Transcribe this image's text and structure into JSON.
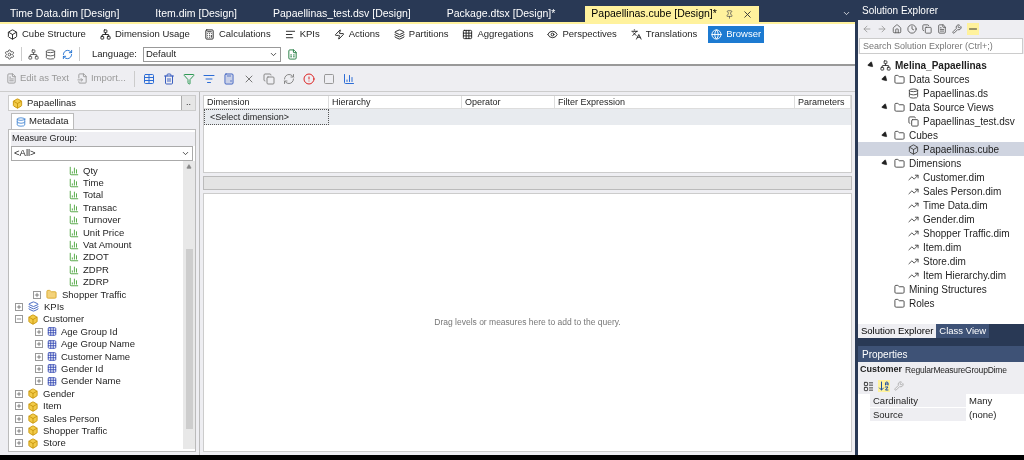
{
  "document_tabs": [
    {
      "label": "Time Data.dim [Design]",
      "selected": false
    },
    {
      "label": "Item.dim [Design]",
      "selected": false
    },
    {
      "label": "Papaellinas_test.dsv [Design]",
      "selected": false
    },
    {
      "label": "Package.dtsx [Design]*",
      "selected": false
    },
    {
      "label": "Papaellinas.cube [Design]*",
      "selected": true
    }
  ],
  "designer_tabs": [
    {
      "label": "Cube Structure",
      "selected": false
    },
    {
      "label": "Dimension Usage",
      "selected": false
    },
    {
      "label": "Calculations",
      "selected": false
    },
    {
      "label": "KPIs",
      "selected": false
    },
    {
      "label": "Actions",
      "selected": false
    },
    {
      "label": "Partitions",
      "selected": false
    },
    {
      "label": "Aggregations",
      "selected": false
    },
    {
      "label": "Perspectives",
      "selected": false
    },
    {
      "label": "Translations",
      "selected": false
    },
    {
      "label": "Browser",
      "selected": true
    }
  ],
  "browser_toolbar": {
    "language_label": "Language:",
    "language_value": "Default"
  },
  "query_toolbar": {
    "edit_as_text": "Edit as Text",
    "import": "Import..."
  },
  "cube_selector": {
    "value": "Papaellinas",
    "button": ".."
  },
  "metadata_tab": {
    "label": "Metadata",
    "selected": true
  },
  "measure_group": {
    "label": "Measure Group:",
    "value": "<All>"
  },
  "metadata_tree": [
    {
      "kind": "measure",
      "label": "Qty"
    },
    {
      "kind": "measure",
      "label": "Time"
    },
    {
      "kind": "measure",
      "label": "Total"
    },
    {
      "kind": "measure",
      "label": "Transac"
    },
    {
      "kind": "measure",
      "label": "Turnover"
    },
    {
      "kind": "measure",
      "label": "Unit Price"
    },
    {
      "kind": "measure",
      "label": "Vat Amount"
    },
    {
      "kind": "measure",
      "label": "ZDOT"
    },
    {
      "kind": "measure",
      "label": "ZDPR"
    },
    {
      "kind": "measure",
      "label": "ZDRP"
    },
    {
      "kind": "folder",
      "label": "Shopper Traffic",
      "expanded": false
    },
    {
      "kind": "kpi",
      "label": "KPIs",
      "expanded": false
    },
    {
      "kind": "dimension",
      "label": "Customer",
      "expanded": true,
      "children": [
        {
          "kind": "attribute",
          "label": "Age Group Id",
          "expanded": false
        },
        {
          "kind": "attribute",
          "label": "Age Group Name",
          "expanded": false
        },
        {
          "kind": "attribute",
          "label": "Customer Name",
          "expanded": false
        },
        {
          "kind": "attribute",
          "label": "Gender Id",
          "expanded": false
        },
        {
          "kind": "attribute",
          "label": "Gender Name",
          "expanded": false
        }
      ]
    },
    {
      "kind": "dimension",
      "label": "Gender",
      "expanded": false
    },
    {
      "kind": "dimension",
      "label": "Item",
      "expanded": false
    },
    {
      "kind": "dimension",
      "label": "Sales Person",
      "expanded": false
    },
    {
      "kind": "dimension",
      "label": "Shopper Traffic",
      "expanded": false
    },
    {
      "kind": "dimension",
      "label": "Store",
      "expanded": false
    }
  ],
  "filter_grid": {
    "columns": [
      "Dimension",
      "Hierarchy",
      "Operator",
      "Filter Expression",
      "Parameters"
    ],
    "rows": [
      [
        "<Select dimension>"
      ]
    ]
  },
  "drop_area": {
    "hint": "Drag levels or measures here to add to the query."
  },
  "solution_explorer": {
    "title": "Solution Explorer",
    "search_placeholder": "Search Solution Explorer (Ctrl+;)",
    "tree": [
      {
        "kind": "project",
        "label": "Melina_Papaellinas",
        "expanded": true,
        "selected": false,
        "children": [
          {
            "kind": "folder",
            "label": "Data Sources",
            "expanded": true,
            "selected": false,
            "children": [
              {
                "kind": "datasource",
                "label": "Papaellinas.ds",
                "selected": false
              }
            ]
          },
          {
            "kind": "folder",
            "label": "Data Source Views",
            "expanded": true,
            "selected": false,
            "children": [
              {
                "kind": "dsv",
                "label": "Papaellinas_test.dsv",
                "selected": false
              }
            ]
          },
          {
            "kind": "folder",
            "label": "Cubes",
            "expanded": true,
            "selected": false,
            "children": [
              {
                "kind": "cube",
                "label": "Papaellinas.cube",
                "selected": true
              }
            ]
          },
          {
            "kind": "folder",
            "label": "Dimensions",
            "expanded": true,
            "selected": false,
            "children": [
              {
                "kind": "dimension",
                "label": "Customer.dim",
                "selected": false
              },
              {
                "kind": "dimension",
                "label": "Sales Person.dim",
                "selected": false
              },
              {
                "kind": "dimension",
                "label": "Time Data.dim",
                "selected": false
              },
              {
                "kind": "dimension",
                "label": "Gender.dim",
                "selected": false
              },
              {
                "kind": "dimension",
                "label": "Shopper Traffic.dim",
                "selected": false
              },
              {
                "kind": "dimension",
                "label": "Item.dim",
                "selected": false
              },
              {
                "kind": "dimension",
                "label": "Store.dim",
                "selected": false
              },
              {
                "kind": "dimension",
                "label": "Item Hierarchy.dim",
                "selected": false
              }
            ]
          },
          {
            "kind": "folder",
            "label": "Mining Structures",
            "selected": false
          },
          {
            "kind": "folder",
            "label": "Roles",
            "selected": false
          }
        ]
      }
    ],
    "tabs": [
      {
        "label": "Solution Explorer",
        "selected": true
      },
      {
        "label": "Class View",
        "selected": false
      }
    ]
  },
  "properties": {
    "title": "Properties",
    "object_name": "Customer",
    "object_type": "RegularMeasureGroupDime",
    "rows": [
      {
        "name": "Cardinality",
        "value": "Many"
      },
      {
        "name": "Source",
        "value": "(none)"
      }
    ]
  }
}
